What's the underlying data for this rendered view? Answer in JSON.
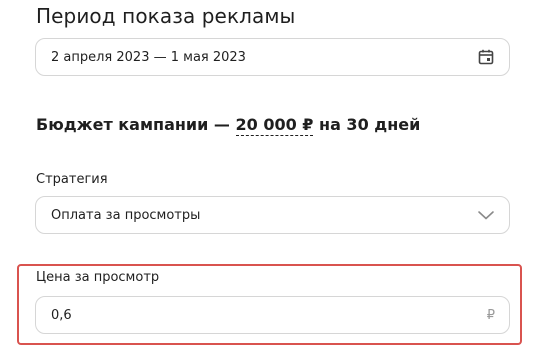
{
  "period": {
    "title": "Период показа рекламы",
    "date_range": "2 апреля 2023 — 1 мая 2023",
    "icon": "calendar-icon"
  },
  "budget": {
    "prefix": "Бюджет кампании — ",
    "amount": "20 000 ₽",
    "suffix": " на 30 дней"
  },
  "strategy": {
    "label": "Стратегия",
    "selected": "Оплата за просмотры",
    "icon": "chevron-down-icon"
  },
  "price": {
    "label": "Цена за просмотр",
    "value": "0,6",
    "currency": "₽"
  },
  "colors": {
    "highlight": "#d9534f",
    "border": "#d6d6d6",
    "text": "#1f1f1f"
  }
}
